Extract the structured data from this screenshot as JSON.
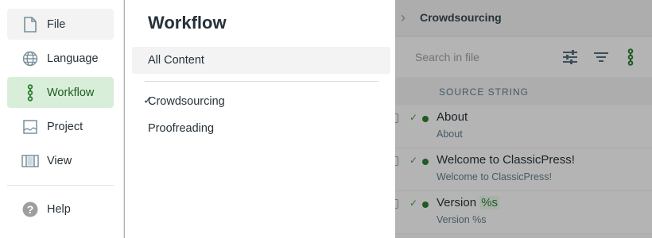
{
  "menu": {
    "items": [
      {
        "label": "File",
        "icon": "file-icon"
      },
      {
        "label": "Language",
        "icon": "globe-icon"
      },
      {
        "label": "Workflow",
        "icon": "workflow-icon"
      },
      {
        "label": "Project",
        "icon": "project-icon"
      },
      {
        "label": "View",
        "icon": "view-icon"
      }
    ],
    "help": {
      "label": "Help",
      "icon": "help-icon"
    }
  },
  "panel": {
    "title": "Workflow",
    "all_content": "All Content",
    "options": [
      {
        "label": "Crowdsourcing",
        "checked": true
      },
      {
        "label": "Proofreading",
        "checked": false
      }
    ]
  },
  "editor": {
    "title": "Crowdsourcing",
    "search_placeholder": "Search in file",
    "column_header": "SOURCE STRING",
    "rows": [
      {
        "source": "About",
        "placeholder": "",
        "translation": "About"
      },
      {
        "source": "Welcome to ClassicPress!",
        "placeholder": "",
        "translation": "Welcome to ClassicPress!"
      },
      {
        "source": "Version ",
        "placeholder": "%s",
        "translation": "Version %s"
      }
    ]
  },
  "colors": {
    "accent": "#2e7d32",
    "active_bg": "#d9eed9",
    "overlay": "rgba(0,0,0,0.28)"
  }
}
